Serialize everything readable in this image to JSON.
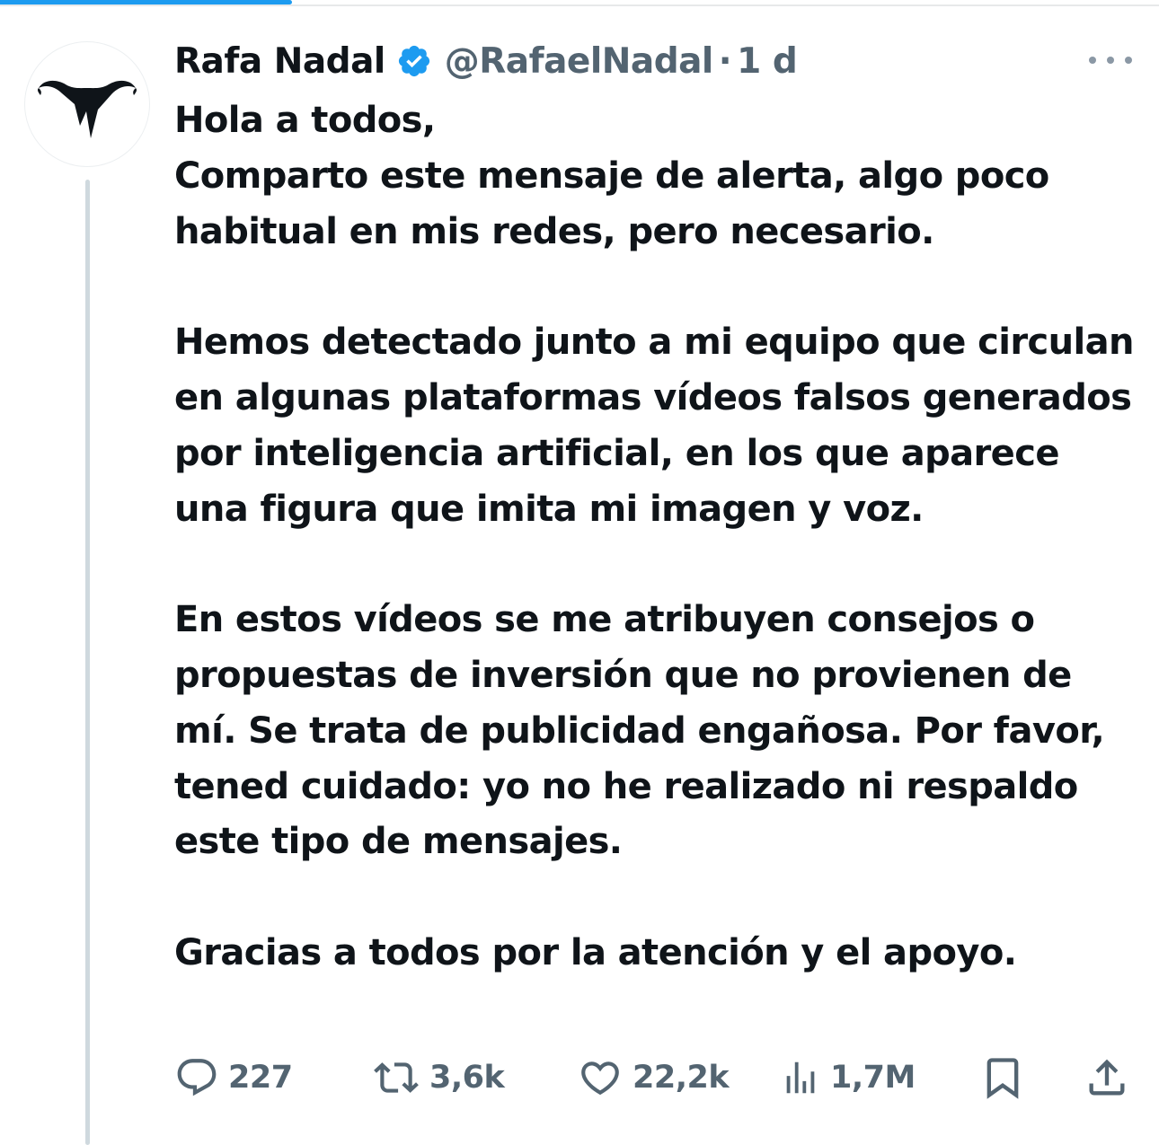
{
  "author": {
    "display_name": "Rafa Nadal",
    "handle": "@RafaelNadal",
    "separator": "·",
    "time": "1 d",
    "verified": true,
    "verified_color": "#1d9bf0"
  },
  "tweet": {
    "paragraphs": [
      "Hola a todos,\nComparto este mensaje de alerta, algo poco habitual en mis redes, pero necesario.",
      "Hemos detectado junto a mi equipo que circulan en algunas plataformas vídeos falsos generados por inteligencia artificial, en los que aparece una figura que imita mi imagen y voz.",
      "En estos vídeos se me atribuyen consejos o propuestas de inversión que no provienen de mí. Se trata de publicidad engañosa. Por favor, tened cuidado: yo no he realizado ni respaldo este tipo de mensajes.",
      "Gracias a todos por la atención y el apoyo."
    ]
  },
  "stats": {
    "replies": "227",
    "reposts": "3,6k",
    "likes": "22,2k",
    "views": "1,7M"
  },
  "icons": {
    "reply": "reply-icon",
    "repost": "repost-icon",
    "like": "like-icon",
    "views": "views-icon",
    "bookmark": "bookmark-icon",
    "share": "share-icon",
    "more": "more-icon",
    "verified": "verified-badge-icon",
    "avatar_logo": "bull-logo-icon"
  },
  "colors": {
    "text": "#0f1419",
    "secondary": "#536471",
    "accent": "#1d9bf0",
    "thread_line": "#cfd9de"
  }
}
